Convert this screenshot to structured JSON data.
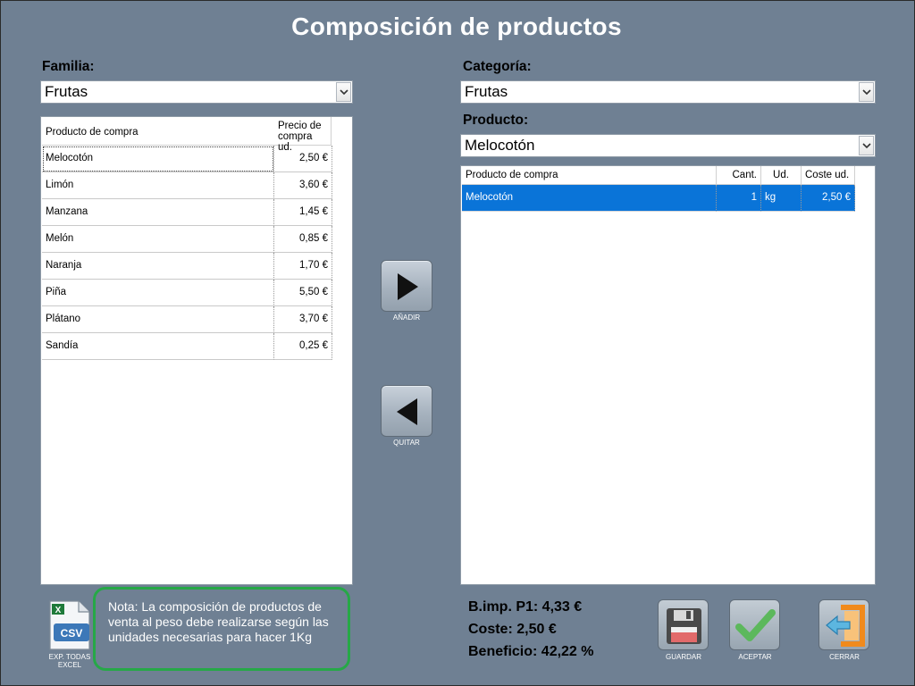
{
  "window": {
    "title": "Composición de productos"
  },
  "left": {
    "family_label": "Familia:",
    "family_value": "Frutas",
    "grid": {
      "headers": [
        "Producto de compra",
        "Precio de compra ud."
      ],
      "header_price_line1": "Precio de",
      "header_price_line2": "compra ud.",
      "rows": [
        {
          "producto": "Melocotón",
          "precio": "2,50 €"
        },
        {
          "producto": "Limón",
          "precio": "3,60 €"
        },
        {
          "producto": "Manzana",
          "precio": "1,45 €"
        },
        {
          "producto": "Melón",
          "precio": "0,85 €"
        },
        {
          "producto": "Naranja",
          "precio": "1,70 €"
        },
        {
          "producto": "Piña",
          "precio": "5,50 €"
        },
        {
          "producto": "Plátano",
          "precio": "3,70 €"
        },
        {
          "producto": "Sandía",
          "precio": "0,25 €"
        }
      ]
    }
  },
  "right": {
    "category_label": "Categoría:",
    "category_value": "Frutas",
    "product_label": "Producto:",
    "product_value": "Melocotón",
    "grid": {
      "headers": [
        "Producto de compra",
        "Cant.",
        "Ud.",
        "Coste ud."
      ],
      "rows": [
        {
          "producto": "Melocotón",
          "cant": "1",
          "ud": "kg",
          "coste": "2,50 €"
        }
      ]
    }
  },
  "actions": {
    "add_label": "AÑADIR",
    "remove_label": "QUITAR",
    "export_label_line1": "EXP. TODAS",
    "export_label_line2": "EXCEL",
    "export_icon_text": "CSV",
    "save_label": "GUARDAR",
    "accept_label": "ACEPTAR",
    "close_label": "CERRAR"
  },
  "note": {
    "text": "Nota: La composición de productos de venta al peso debe realizarse según las unidades necesarias para hacer 1Kg"
  },
  "totals": {
    "bimp": "B.imp. P1: 4,33 €",
    "coste": "Coste: 2,50 €",
    "beneficio": "Beneficio: 42,22 %"
  },
  "colors": {
    "background": "#6f8093",
    "selection": "#0a74d8",
    "note_border": "#26a847",
    "close_accent": "#f08a1c"
  }
}
